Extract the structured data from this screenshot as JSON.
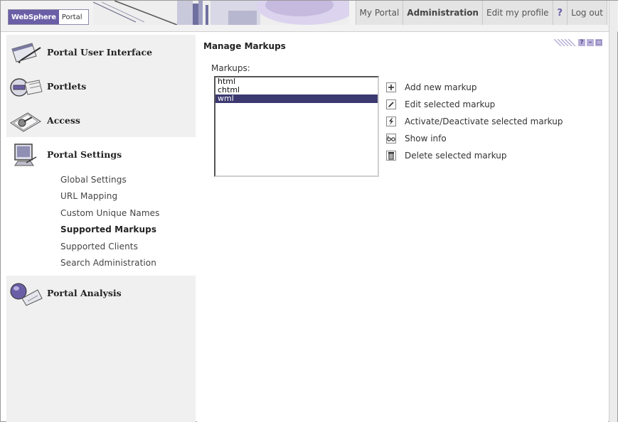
{
  "header": {
    "logo_brand": "WebSphere",
    "logo_product": "Portal",
    "nav": [
      {
        "label": "My Portal"
      },
      {
        "label": "Administration"
      },
      {
        "label": "Edit my profile"
      },
      {
        "label": "?"
      },
      {
        "label": "Log out"
      }
    ]
  },
  "sidebar": {
    "sections": [
      {
        "label": "Portal User Interface",
        "icon": "window-pen-icon"
      },
      {
        "label": "Portlets",
        "icon": "portlet-icon"
      },
      {
        "label": "Access",
        "icon": "key-folder-icon"
      },
      {
        "label": "Portal Settings",
        "icon": "monitor-icon"
      },
      {
        "label": "Portal Analysis",
        "icon": "sphere-chart-icon"
      }
    ],
    "settings_items": [
      {
        "label": "Global Settings"
      },
      {
        "label": "URL Mapping"
      },
      {
        "label": "Custom Unique Names"
      },
      {
        "label": "Supported Markups"
      },
      {
        "label": "Supported Clients"
      },
      {
        "label": "Search Administration"
      }
    ],
    "selected_item": "Supported Markups"
  },
  "main": {
    "title": "Manage Markups",
    "controls": [
      {
        "label": "?"
      },
      {
        "label": "–"
      },
      {
        "label": "□"
      }
    ],
    "markups_label": "Markups:",
    "markups": [
      "html",
      "chtml",
      "wml"
    ],
    "selected_markup": "wml",
    "actions": [
      {
        "label": "Add new markup",
        "icon": "plus-icon"
      },
      {
        "label": "Edit selected markup",
        "icon": "pencil-icon"
      },
      {
        "label": "Activate/Deactivate selected markup",
        "icon": "lightning-icon"
      },
      {
        "label": "Show info",
        "icon": "glasses-icon"
      },
      {
        "label": "Delete selected markup",
        "icon": "trash-icon"
      }
    ]
  },
  "colors": {
    "accent": "#6a5fa6",
    "selection": "#3b3970",
    "sidebar_bg": "#f0f0f0"
  }
}
